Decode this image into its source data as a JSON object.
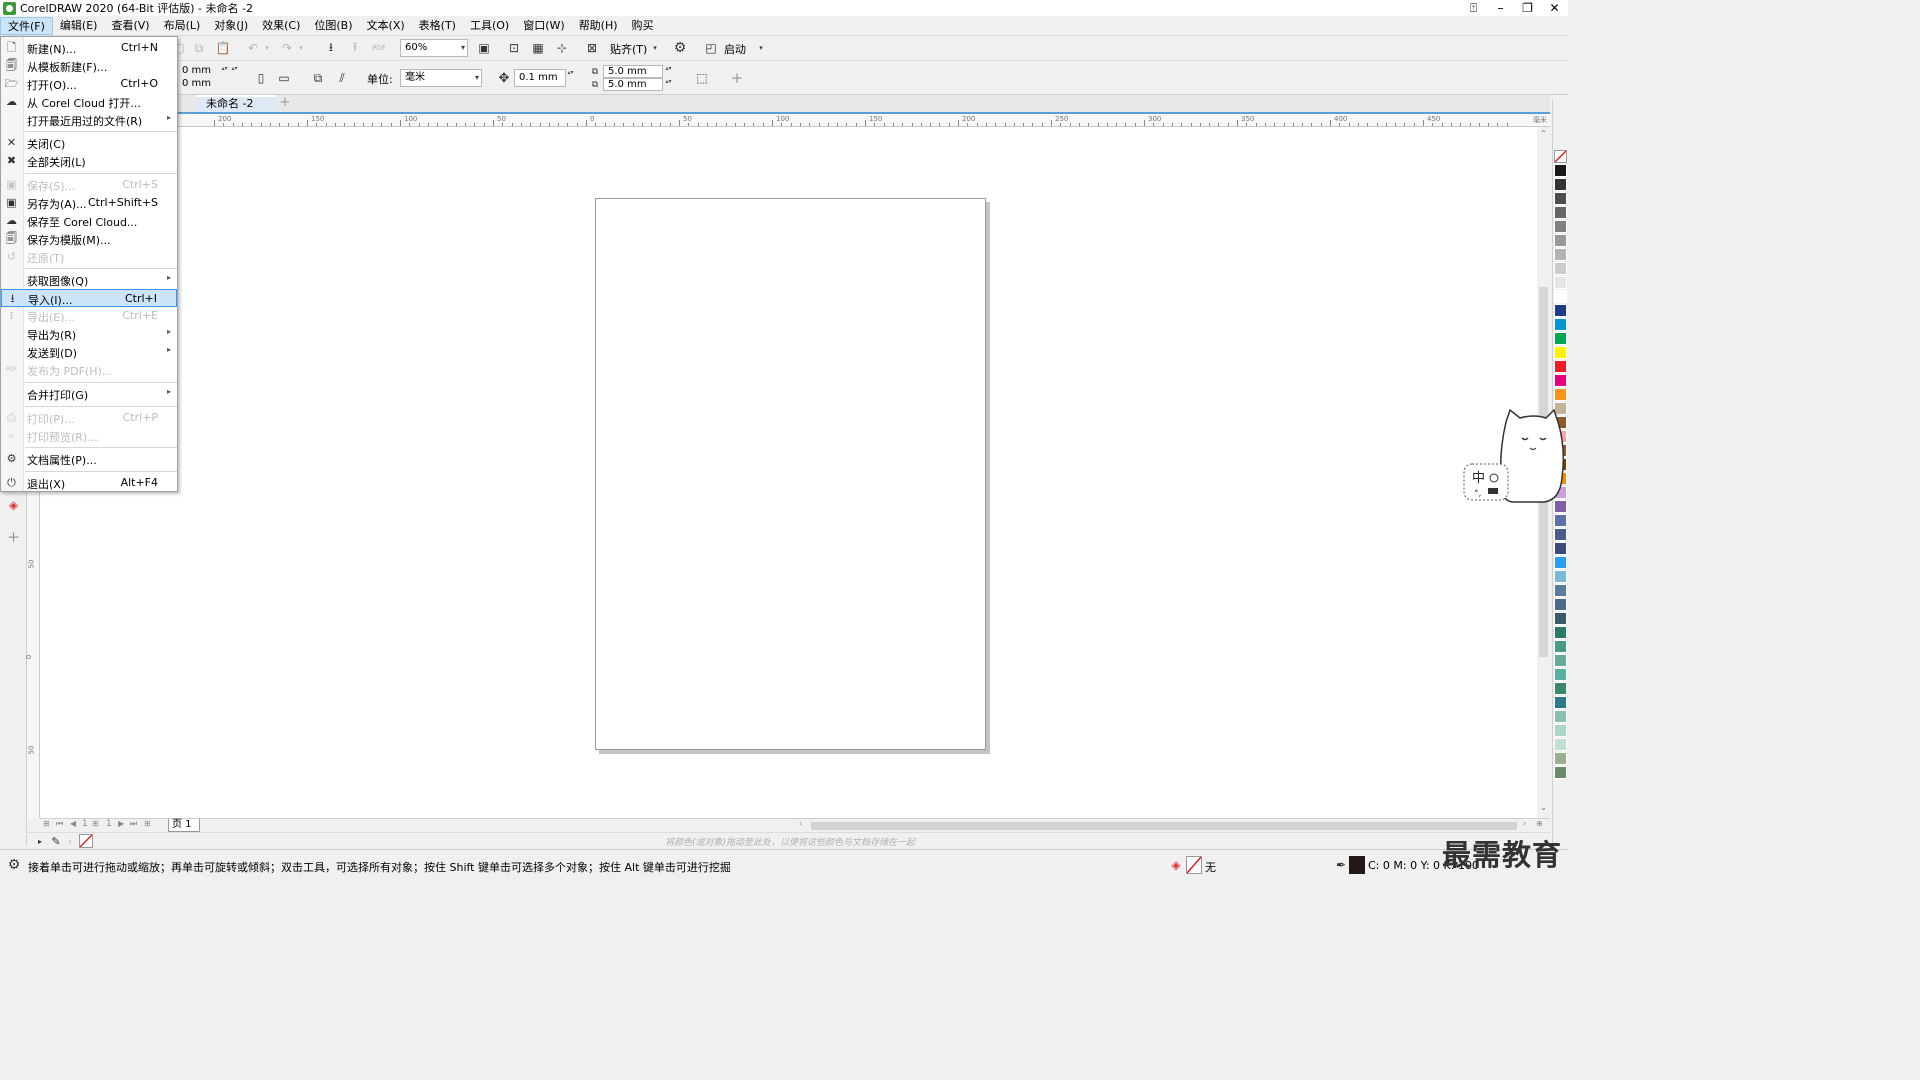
{
  "window": {
    "title": "CorelDRAW 2020 (64-Bit 评估版) - 未命名 -2"
  },
  "menubar": [
    "文件(F)",
    "编辑(E)",
    "查看(V)",
    "布局(L)",
    "对象(J)",
    "效果(C)",
    "位图(B)",
    "文本(X)",
    "表格(T)",
    "工具(O)",
    "窗口(W)",
    "帮助(H)",
    "购买"
  ],
  "toolbar": {
    "zoom": "60%",
    "snap_label": "贴齐(T)",
    "launch_label": "启动",
    "pos_x": "0 mm",
    "pos_y": "0 mm",
    "unit_label": "单位:",
    "unit_value": "毫米",
    "nudge": "0.1 mm",
    "dup_x": "5.0 mm",
    "dup_y": "5.0 mm"
  },
  "doc_tab": "未命名 -2",
  "file_menu": [
    {
      "label": "新建(N)...",
      "shortcut": "Ctrl+N",
      "icon": "new-doc-icon",
      "glyph": "🗋",
      "disabled": false
    },
    {
      "label": "从模板新建(F)...",
      "shortcut": "",
      "icon": "template-icon",
      "glyph": "🗐",
      "disabled": false
    },
    {
      "label": "打开(O)...",
      "shortcut": "Ctrl+O",
      "icon": "open-folder-icon",
      "glyph": "🗁",
      "disabled": false
    },
    {
      "label": "从 Corel Cloud 打开...",
      "shortcut": "",
      "icon": "cloud-open-icon",
      "glyph": "☁",
      "disabled": false
    },
    {
      "label": "打开最近用过的文件(R)",
      "shortcut": "",
      "icon": "",
      "glyph": "",
      "disabled": false,
      "submenu": true
    },
    {
      "label": "关闭(C)",
      "shortcut": "",
      "icon": "close-doc-icon",
      "glyph": "✕",
      "disabled": false
    },
    {
      "label": "全部关闭(L)",
      "shortcut": "",
      "icon": "close-all-icon",
      "glyph": "✖",
      "disabled": false
    },
    {
      "label": "保存(S)...",
      "shortcut": "Ctrl+S",
      "icon": "save-icon",
      "glyph": "▣",
      "disabled": true
    },
    {
      "label": "另存为(A)...",
      "shortcut": "Ctrl+Shift+S",
      "icon": "save-as-icon",
      "glyph": "▣",
      "disabled": false
    },
    {
      "label": "保存至 Corel Cloud...",
      "shortcut": "",
      "icon": "cloud-save-icon",
      "glyph": "☁",
      "disabled": false
    },
    {
      "label": "保存为模版(M)...",
      "shortcut": "",
      "icon": "save-template-icon",
      "glyph": "🗐",
      "disabled": false
    },
    {
      "label": "还原(T)",
      "shortcut": "",
      "icon": "revert-icon",
      "glyph": "↺",
      "disabled": true
    },
    {
      "label": "获取图像(Q)",
      "shortcut": "",
      "icon": "",
      "glyph": "",
      "disabled": false,
      "submenu": true
    },
    {
      "label": "导入(I)...",
      "shortcut": "Ctrl+I",
      "icon": "import-icon",
      "glyph": "⭳",
      "disabled": false,
      "hover": true
    },
    {
      "label": "导出(E)...",
      "shortcut": "Ctrl+E",
      "icon": "export-icon",
      "glyph": "⭱",
      "disabled": true
    },
    {
      "label": "导出为(R)",
      "shortcut": "",
      "icon": "",
      "glyph": "",
      "disabled": false,
      "submenu": true
    },
    {
      "label": "发送到(D)",
      "shortcut": "",
      "icon": "",
      "glyph": "",
      "disabled": false,
      "submenu": true
    },
    {
      "label": "发布为 PDF(H)...",
      "shortcut": "",
      "icon": "pdf-icon",
      "glyph": "PDF",
      "disabled": true
    },
    {
      "label": "合并打印(G)",
      "shortcut": "",
      "icon": "",
      "glyph": "",
      "disabled": false,
      "submenu": true
    },
    {
      "label": "打印(P)...",
      "shortcut": "Ctrl+P",
      "icon": "print-icon",
      "glyph": "⎙",
      "disabled": true
    },
    {
      "label": "打印预览(R)...",
      "shortcut": "",
      "icon": "print-preview-icon",
      "glyph": "⌕",
      "disabled": true
    },
    {
      "label": "文档属性(P)...",
      "shortcut": "",
      "icon": "doc-properties-icon",
      "glyph": "⚙",
      "disabled": false
    },
    {
      "label": "退出(X)",
      "shortcut": "Alt+F4",
      "icon": "exit-icon",
      "glyph": "⏻",
      "disabled": false
    }
  ],
  "ruler_ticks": [
    "200",
    "150",
    "100",
    "50",
    "0",
    "50",
    "100",
    "150",
    "200",
    "250",
    "300",
    "350",
    "400",
    "450"
  ],
  "ruler_unit": "毫米",
  "vruler_ticks": [
    "50",
    "0",
    "50"
  ],
  "page_tab": "页 1",
  "page_nav": {
    "current": "1",
    "of": "1"
  },
  "doc_palette_hint": "将颜色(或对象)拖动至此处，以便将这些颜色与文档存储在一起",
  "status": {
    "message": "接着单击可进行拖动或缩放；再单击可旋转或倾斜；双击工具，可选择所有对象；按住 Shift 键单击可选择多个对象；按住 Alt 键单击可进行挖掘",
    "fill_label": "无",
    "cmyk": "C: 0 M: 0 Y: 0 K: 100"
  },
  "watermark": "最需教育",
  "ime": {
    "mode": "中"
  },
  "palette": [
    "#1a1a1a",
    "#333333",
    "#4d4d4d",
    "#666666",
    "#808080",
    "#999999",
    "#b3b3b3",
    "#cccccc",
    "#e6e6e6",
    "#ffffff",
    "#1e3a8a",
    "#0096d6",
    "#00a651",
    "#fff200",
    "#ed1c24",
    "#e6007e",
    "#f7941d",
    "#c7b299",
    "#8b5a2b",
    "#f4a6a6",
    "#a0522d",
    "#7b3f00",
    "#ff8c00",
    "#c9a0dc",
    "#7f5fa8",
    "#5b6fa8",
    "#4a5a8a",
    "#3a4a7a",
    "#2a9df4",
    "#7ab8d9",
    "#5a7a9a",
    "#4a6a8a",
    "#3a5a6a",
    "#2a7a6a",
    "#4a9a8a",
    "#6aa89a",
    "#5ab0a0",
    "#3a8a6a",
    "#2a7a8a",
    "#8ac0b0",
    "#a8d8c8",
    "#c0e0d0",
    "#9ab090",
    "#6a8a6a"
  ]
}
